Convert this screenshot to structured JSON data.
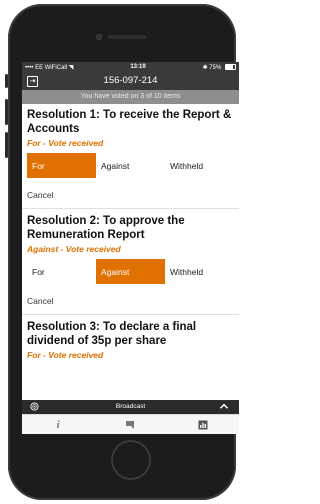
{
  "status_bar": {
    "carrier": "EE WiFiCall",
    "time": "13:19",
    "battery": "75%"
  },
  "header": {
    "title": "156-097-214"
  },
  "progress_text": "You have voted on 3 of 10 items",
  "resolutions": [
    {
      "title": "Resolution 1: To receive the Report & Accounts",
      "status": "For - Vote received",
      "options": [
        "For",
        "Against",
        "Withheld"
      ],
      "selected": "For",
      "cancel_label": "Cancel"
    },
    {
      "title": "Resolution 2: To approve the Remuneration Report",
      "status": "Against - Vote received",
      "options": [
        "For",
        "Against",
        "Withheld"
      ],
      "selected": "Against",
      "cancel_label": "Cancel"
    },
    {
      "title": "Resolution 3: To declare a final dividend of 35p per share",
      "status": "For - Vote received"
    }
  ],
  "broadcast": {
    "label": "Broadcast",
    "icon": "broadcast-icon",
    "chevron": "chevron-up-icon"
  },
  "tabs": [
    {
      "icon": "info-icon"
    },
    {
      "icon": "chat-icon"
    },
    {
      "icon": "chart-icon"
    }
  ],
  "colors": {
    "accent": "#e07000",
    "header_bg": "#3a3a3a",
    "progress_bg": "#8e8e8e"
  }
}
